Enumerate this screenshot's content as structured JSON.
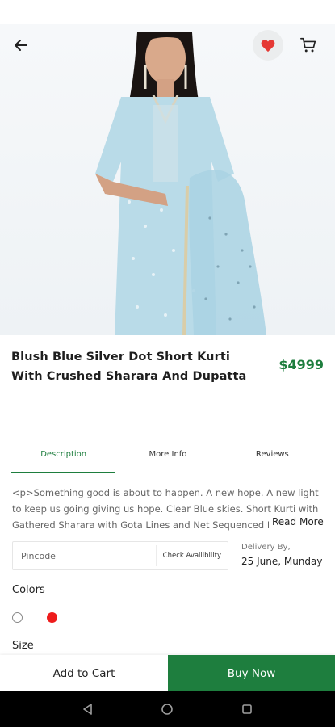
{
  "header": {
    "back_icon": "arrow-left-icon",
    "favorite_icon": "heart-icon",
    "cart_icon": "cart-icon"
  },
  "product": {
    "title": "Blush Blue Silver Dot Short Kurti With Crushed Sharara And Dupatta",
    "price": "$4999",
    "image_alt": "Model wearing blush blue kurti with sharara and dupatta"
  },
  "tabs": [
    {
      "label": "Description",
      "active": true
    },
    {
      "label": "More Info",
      "active": false
    },
    {
      "label": "Reviews",
      "active": false
    }
  ],
  "description": {
    "text": "<p>Something good is about to happen. A new hope. A new light to keep us going giving us hope. Clear Blue skies. Short Kurti with Gathered Sharara with Gota Lines and Net Sequenced D",
    "read_more": "Read More"
  },
  "delivery": {
    "pincode_placeholder": "Pincode",
    "check_label": "Check Availibility",
    "label": "Delivery By,",
    "date": "25 June, Munday"
  },
  "colors": {
    "heading": "Colors",
    "options": [
      "#ffffff",
      "#ee1c1c"
    ]
  },
  "size": {
    "heading": "Size"
  },
  "actions": {
    "add_to_cart": "Add to Cart",
    "buy_now": "Buy Now"
  },
  "theme": {
    "accent": "#1e7e3e",
    "heart": "#e53935"
  }
}
